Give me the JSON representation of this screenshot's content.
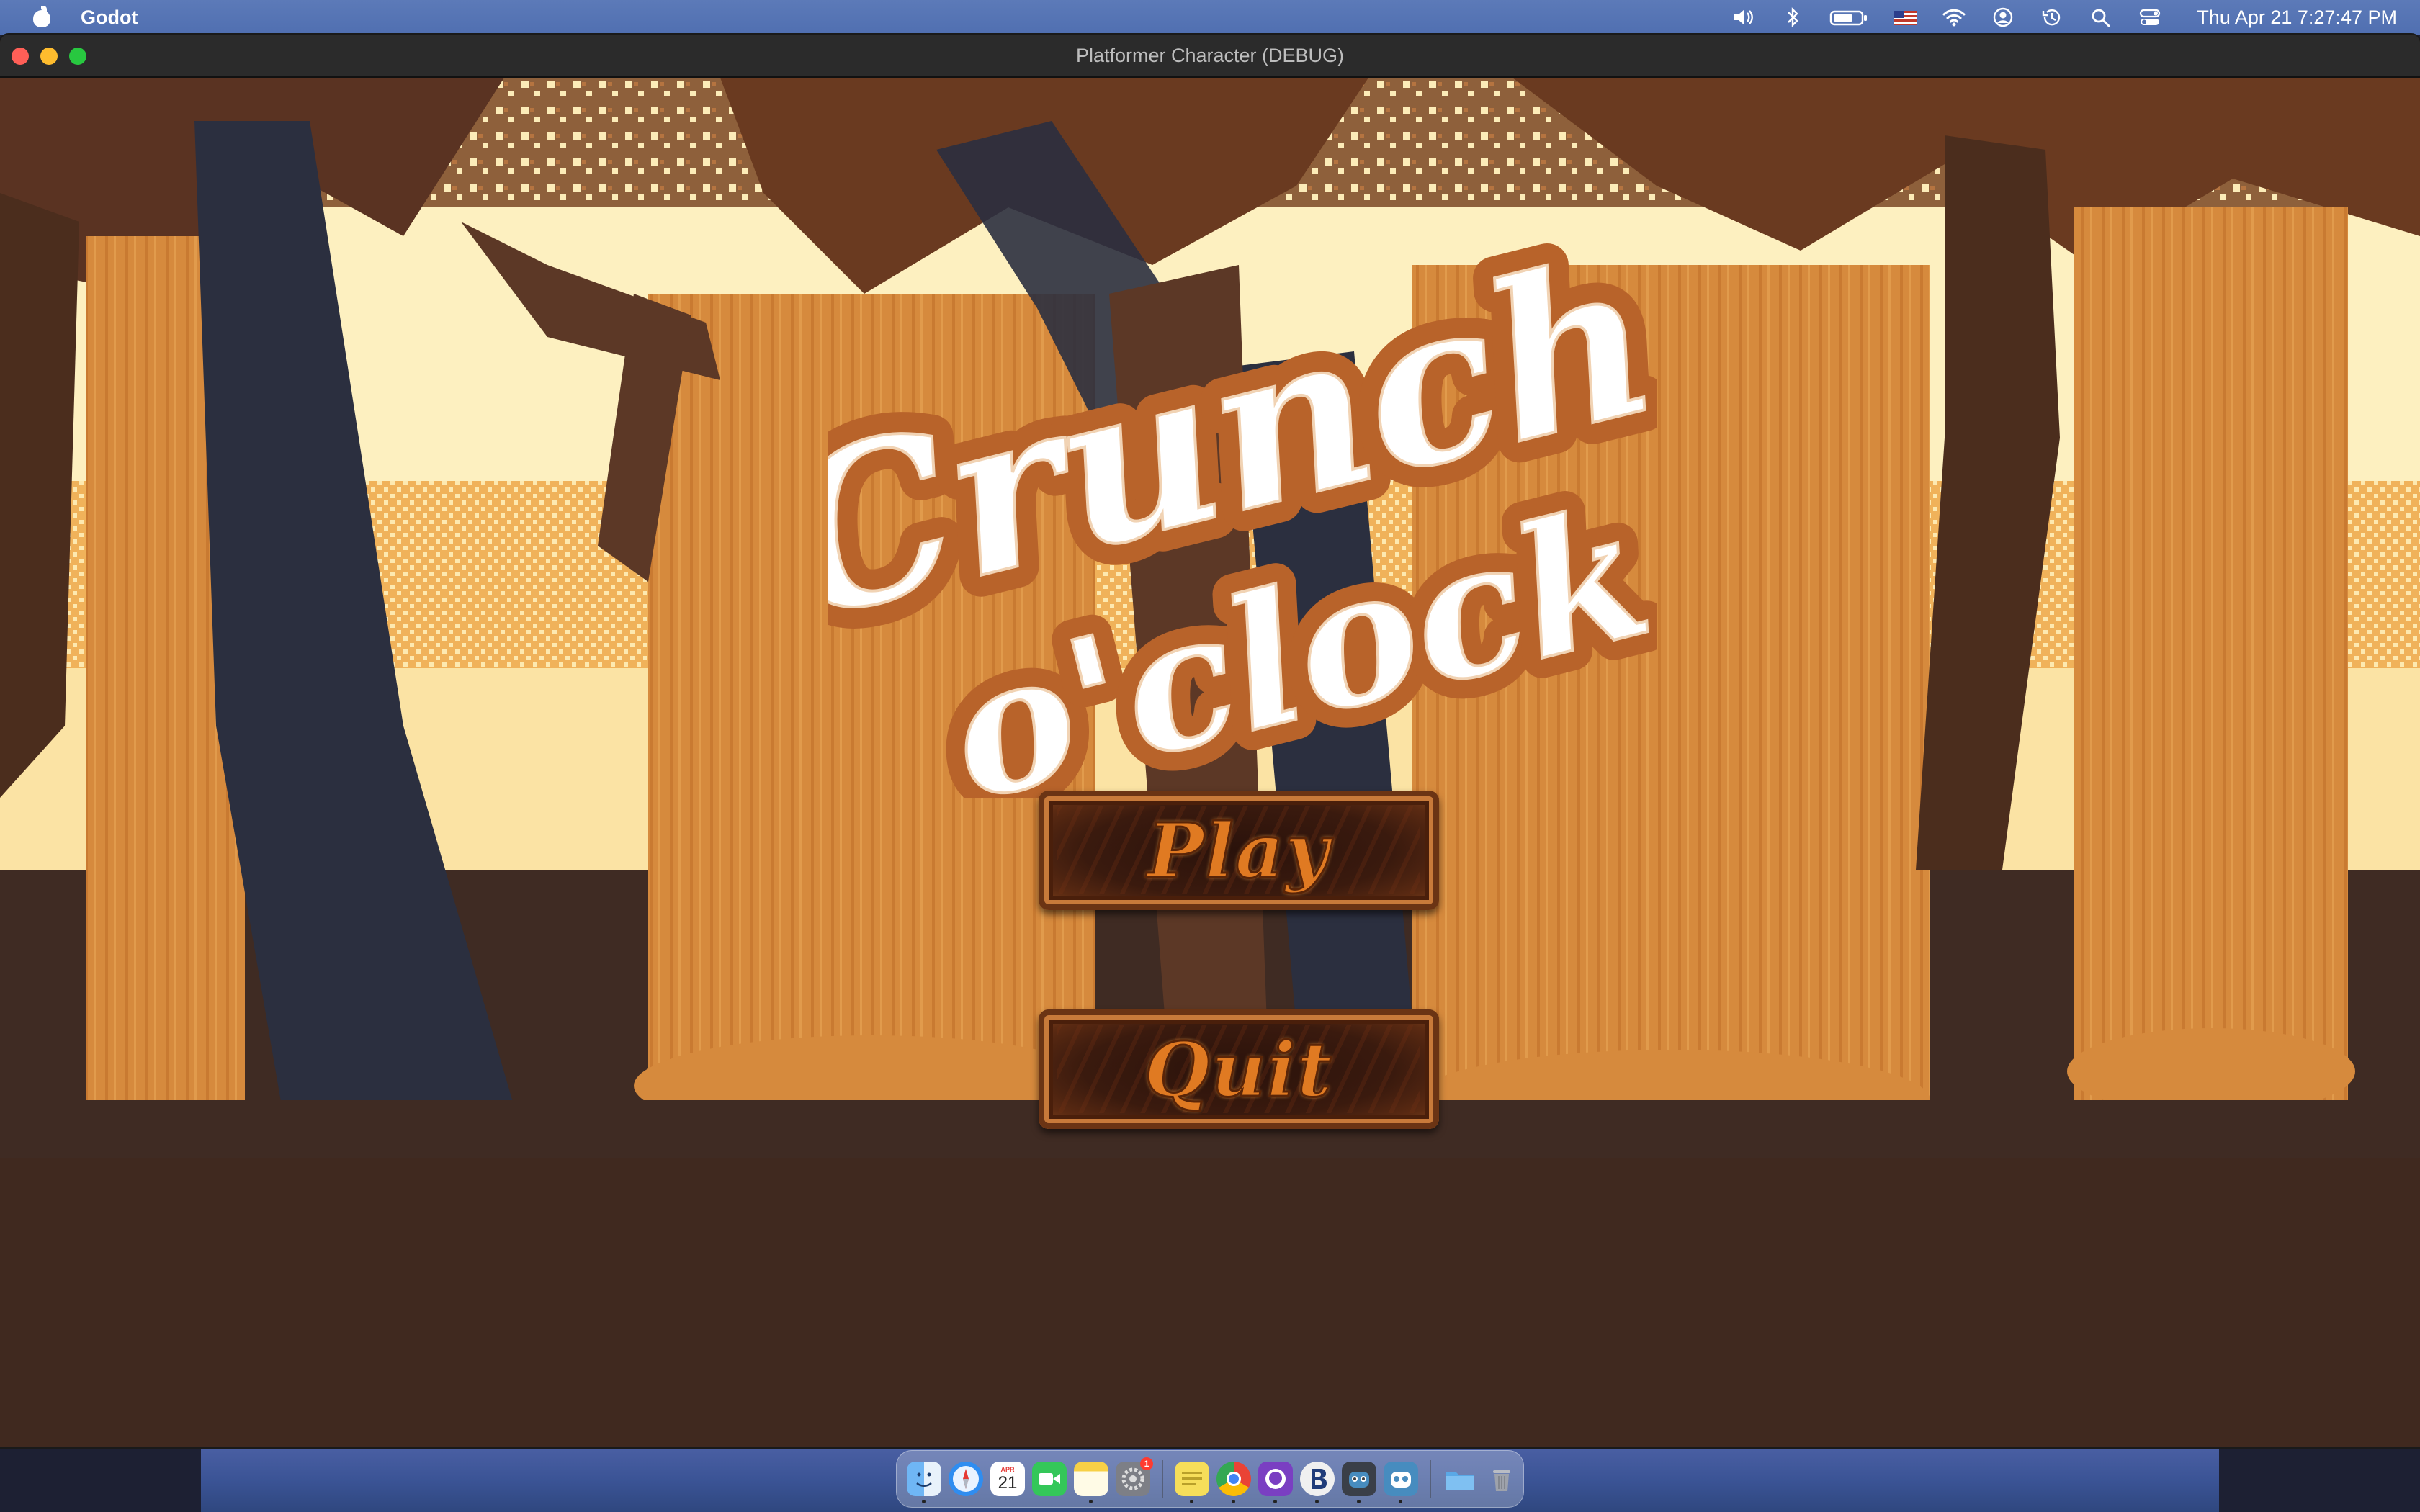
{
  "menubar": {
    "app_name": "Godot",
    "clock": "Thu Apr 21  7:27:47 PM",
    "status_icons": [
      "volume-icon",
      "bluetooth-icon",
      "battery-icon",
      "us-flag-icon",
      "wifi-icon",
      "user-icon",
      "time-machine-icon",
      "spotlight-icon",
      "control-center-icon"
    ]
  },
  "window": {
    "title": "Platformer Character (DEBUG)"
  },
  "game": {
    "title_line1": "Crunch",
    "title_line2": "o'clock",
    "play_label": "Play",
    "quit_label": "Quit"
  },
  "dock": {
    "calendar_day": "21",
    "calendar_month": "APR",
    "notification_badge": "1",
    "items": [
      "finder-icon",
      "safari-icon",
      "calendar-icon",
      "facetime-icon",
      "notes-icon",
      "system-preferences-icon",
      "stickies-icon",
      "chrome-icon",
      "github-desktop-icon",
      "bbedit-icon",
      "godot-icon",
      "godot-icon-2",
      "downloads-folder-icon",
      "trash-icon"
    ]
  },
  "colors": {
    "sky_light": "#fdeeb4",
    "tree_orange": "#d98a3b",
    "tree_dark": "#2c3040",
    "ground": "#3f2b23",
    "title_outline": "#b8632a",
    "button_text": "#e07a22"
  }
}
